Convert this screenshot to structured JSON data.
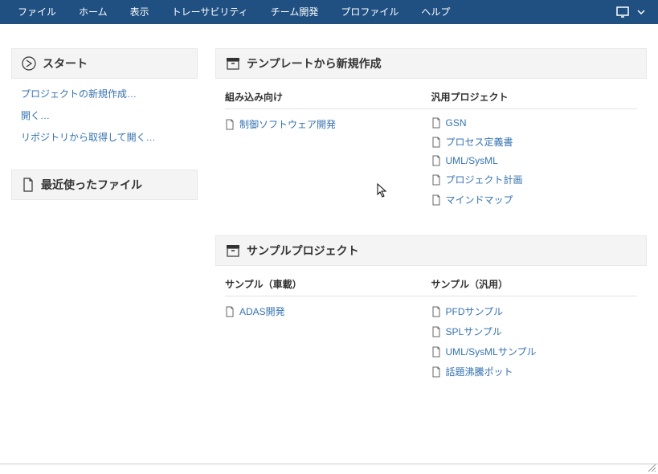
{
  "menubar": {
    "items": [
      "ファイル",
      "ホーム",
      "表示",
      "トレーサビリティ",
      "チーム開発",
      "プロファイル",
      "ヘルプ"
    ]
  },
  "start": {
    "title": "スタート",
    "links": [
      "プロジェクトの新規作成…",
      "開く…",
      "リポジトリから取得して開く…"
    ]
  },
  "recent": {
    "title": "最近使ったファイル"
  },
  "templates": {
    "title": "テンプレートから新規作成",
    "col1": {
      "header": "組み込み向け",
      "items": [
        "制御ソフトウェア開発"
      ]
    },
    "col2": {
      "header": "汎用プロジェクト",
      "items": [
        "GSN",
        "プロセス定義書",
        "UML/SysML",
        "プロジェクト計画",
        "マインドマップ"
      ]
    }
  },
  "samples": {
    "title": "サンプルプロジェクト",
    "col1": {
      "header": "サンプル（車載）",
      "items": [
        "ADAS開発"
      ]
    },
    "col2": {
      "header": "サンプル（汎用）",
      "items": [
        "PFDサンプル",
        "SPLサンプル",
        "UML/SysMLサンプル",
        "話題沸騰ポット"
      ]
    }
  }
}
